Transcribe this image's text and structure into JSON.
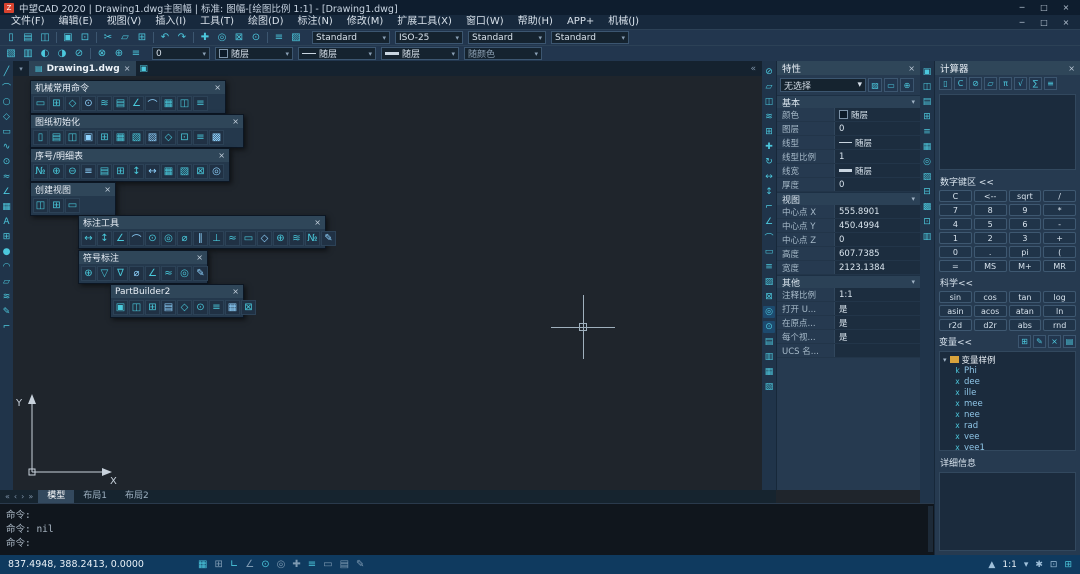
{
  "ui": {
    "chevron_down": "▾",
    "close": "×",
    "collapse": "«",
    "min": "─",
    "max": "□"
  },
  "titlebar": {
    "logo_glyph": "Z",
    "title": "中望CAD 2020 | Drawing1.dwg主图幅 | 标准: 图幅-[绘图比例 1:1] - [Drawing1.dwg]"
  },
  "menubar": {
    "items": [
      "文件(F)",
      "编辑(E)",
      "视图(V)",
      "插入(I)",
      "工具(T)",
      "绘图(D)",
      "标注(N)",
      "修改(M)",
      "扩展工具(X)",
      "窗口(W)",
      "帮助(H)",
      "APP+",
      "机械(J)"
    ]
  },
  "toolbar1": {
    "icons": [
      {
        "n": "new-icon",
        "g": "▯"
      },
      {
        "n": "open-icon",
        "g": "▤"
      },
      {
        "n": "save-icon",
        "g": "◫"
      },
      {
        "n": "separator",
        "cls": "sep"
      },
      {
        "n": "plot-icon",
        "g": "▣"
      },
      {
        "n": "preview-icon",
        "g": "⊡"
      },
      {
        "n": "separator",
        "cls": "sep"
      },
      {
        "n": "cut-icon",
        "g": "✂"
      },
      {
        "n": "copy-icon",
        "g": "▱"
      },
      {
        "n": "paste-icon",
        "g": "⊞"
      },
      {
        "n": "separator",
        "cls": "sep"
      },
      {
        "n": "undo-icon",
        "g": "↶"
      },
      {
        "n": "redo-icon",
        "g": "↷"
      },
      {
        "n": "separator",
        "cls": "sep"
      },
      {
        "n": "pan-icon",
        "g": "✚"
      },
      {
        "n": "zoom-realtime-icon",
        "g": "◎"
      },
      {
        "n": "zoom-window-icon",
        "g": "⊠"
      },
      {
        "n": "zoom-previous-icon",
        "g": "⊙"
      },
      {
        "n": "separator",
        "cls": "sep"
      },
      {
        "n": "properties-icon",
        "g": "≡"
      },
      {
        "n": "match-properties-icon",
        "g": "▨"
      }
    ],
    "combos": [
      {
        "n": "text-style-combo",
        "value": "Standard"
      },
      {
        "n": "dim-style-combo",
        "value": "ISO-25"
      },
      {
        "n": "table-style-combo",
        "value": "Standard"
      },
      {
        "n": "mleader-style-combo",
        "value": "Standard"
      }
    ]
  },
  "toolbar2": {
    "icons": [
      {
        "n": "layer-properties-icon",
        "g": "▧"
      },
      {
        "n": "layer-states-icon",
        "g": "▥"
      },
      {
        "n": "layer-on-icon",
        "g": "◐"
      },
      {
        "n": "layer-freeze-icon",
        "g": "◑"
      },
      {
        "n": "layer-lock-icon",
        "g": "⊘"
      },
      {
        "n": "separator",
        "cls": "sep"
      },
      {
        "n": "layer-isolate-icon",
        "g": "⊗"
      },
      {
        "n": "layer-previous-icon",
        "g": "⊕"
      },
      {
        "n": "layer-walk-icon",
        "g": "≡"
      }
    ],
    "combos": [
      {
        "n": "layer-combo",
        "value": "0"
      },
      {
        "n": "color-combo",
        "value": "随层",
        "cls": "sw"
      },
      {
        "n": "linetype-combo",
        "value": "随层",
        "cls": "dash"
      },
      {
        "n": "lineweight-combo",
        "value": "随层",
        "cls": "thick"
      },
      {
        "n": "plotstyle-combo",
        "value": "随颜色",
        "cls": "dim"
      }
    ]
  },
  "docbar": {
    "tab": "Drawing1.dwg",
    "tab_icon": "▤",
    "new_tab_icon": "▣"
  },
  "left_toolbar": {
    "icons": [
      "╱",
      "⌒",
      "○",
      "◇",
      "▭",
      "∿",
      "⊙",
      "≈",
      "∠",
      "▦",
      "A",
      "⊞",
      "●",
      "◠",
      "▱",
      "≋",
      "✎",
      "⌐"
    ]
  },
  "right_strip1": {
    "icons": [
      "⊘",
      "▱",
      "◫",
      "≋",
      "⊞",
      "✚",
      "↻",
      "↔",
      "↕",
      "⌐",
      "∠",
      "⌒",
      "▭",
      "≡",
      "▨",
      "⊠",
      "◎",
      "⊙",
      "▤",
      "▥",
      "▦",
      "▧"
    ]
  },
  "right_strip2": {
    "icons": [
      "▣",
      "◫",
      "▤",
      "⊞",
      "≡",
      "▦",
      "◎",
      "▨",
      "⊟",
      "▩",
      "⊡",
      "▥"
    ]
  },
  "palettes": {
    "p1": {
      "title": "机械常用命令",
      "icons": [
        "▭",
        "⊞",
        "◇",
        "⊙",
        "≋",
        "▤",
        "∠",
        "⌒",
        "▦",
        "◫",
        "≡"
      ]
    },
    "p2": {
      "title": "图纸初始化",
      "icons": [
        "▯",
        "▤",
        "◫",
        "▣",
        "⊞",
        "▦",
        "▧",
        "▨",
        "◇",
        "⊡",
        "≡",
        "▩"
      ]
    },
    "p3": {
      "title": "序号/明细表",
      "icons": [
        "№",
        "⊕",
        "⊖",
        "≡",
        "▤",
        "⊞",
        "↕",
        "↔",
        "▦",
        "▧",
        "⊠",
        "◎"
      ]
    },
    "p4": {
      "title": "创建视图",
      "icons": [
        "◫",
        "⊞",
        "▭"
      ]
    },
    "p5": {
      "title": "标注工具",
      "icons": [
        "↔",
        "↕",
        "∠",
        "⌒",
        "⊙",
        "◎",
        "⌀",
        "∥",
        "⊥",
        "≈",
        "▭",
        "◇",
        "⊕",
        "≋",
        "№",
        "✎"
      ]
    },
    "p6": {
      "title": "符号标注",
      "icons": [
        "⊕",
        "▽",
        "∇",
        "⌀",
        "∠",
        "≈",
        "◎",
        "✎"
      ]
    },
    "p7": {
      "title": "PartBuilder2",
      "icons": [
        "▣",
        "◫",
        "⊞",
        "▤",
        "◇",
        "⊙",
        "≡",
        "▦",
        "⊠"
      ]
    }
  },
  "props": {
    "title": "特性",
    "selector": "无选择",
    "selector_icons": [
      {
        "n": "quick-select-icon",
        "g": "▨"
      },
      {
        "n": "select-objects-icon",
        "g": "▭"
      },
      {
        "n": "pickadd-toggle-icon",
        "g": "⊕"
      }
    ],
    "sections": {
      "basic": {
        "title": "基本",
        "rows": [
          {
            "label": "颜色",
            "value": "随层",
            "cls": "sw"
          },
          {
            "label": "图层",
            "value": "0"
          },
          {
            "label": "线型",
            "value": "随层",
            "cls": "dash"
          },
          {
            "label": "线型比例",
            "value": "1"
          },
          {
            "label": "线宽",
            "value": "随层",
            "cls": "thick"
          },
          {
            "label": "厚度",
            "value": "0"
          }
        ]
      },
      "view": {
        "title": "视图",
        "rows": [
          {
            "label": "中心点 X",
            "value": "555.8901"
          },
          {
            "label": "中心点 Y",
            "value": "450.4994"
          },
          {
            "label": "中心点 Z",
            "value": "0"
          },
          {
            "label": "高度",
            "value": "607.7385"
          },
          {
            "label": "宽度",
            "value": "2123.1384"
          }
        ]
      },
      "misc": {
        "title": "其他",
        "rows": [
          {
            "label": "注释比例",
            "value": "1:1"
          },
          {
            "label": "打开 U...",
            "value": "是"
          },
          {
            "label": "在原点...",
            "value": "是"
          },
          {
            "label": "每个视...",
            "value": "是"
          },
          {
            "label": "UCS 名...",
            "value": ""
          }
        ]
      }
    }
  },
  "calc": {
    "title": "计算器",
    "toolbar": [
      {
        "n": "new-calc-icon",
        "g": "▯"
      },
      {
        "n": "clear-icon",
        "g": "C"
      },
      {
        "n": "clear-history-icon",
        "g": "⊘"
      },
      {
        "n": "paste-value-icon",
        "g": "▱"
      },
      {
        "n": "units-conversion-icon",
        "g": "π"
      },
      {
        "n": "sqrt-icon",
        "g": "√"
      },
      {
        "n": "sum-icon",
        "g": "∑"
      },
      {
        "n": "options-icon",
        "g": "≡"
      }
    ],
    "numpad_label": "数字键区 <<",
    "numpad": [
      "C",
      "<--",
      "sqrt",
      "/",
      "7",
      "8",
      "9",
      "*",
      "4",
      "5",
      "6",
      "-",
      "1",
      "2",
      "3",
      "+",
      "0",
      ".",
      "pi",
      "(",
      "=",
      "MS",
      "M+",
      "MR"
    ],
    "sci_label": "科学<<",
    "sci": [
      "sin",
      "cos",
      "tan",
      "log",
      "asin",
      "acos",
      "atan",
      "ln",
      "r2d",
      "d2r",
      "abs",
      "rnd"
    ],
    "vars_label": "变量<<",
    "vars_toolbar": [
      {
        "n": "new-variable-icon",
        "g": "⊞"
      },
      {
        "n": "edit-variable-icon",
        "g": "✎"
      },
      {
        "n": "delete-variable-icon",
        "g": "×"
      },
      {
        "n": "return-value-icon",
        "g": "▤"
      }
    ],
    "tree": {
      "folder": "变量样例",
      "items": [
        {
          "t": "k",
          "name": "Phi"
        },
        {
          "t": "x",
          "name": "dee"
        },
        {
          "t": "x",
          "name": "ille"
        },
        {
          "t": "x",
          "name": "mee"
        },
        {
          "t": "x",
          "name": "nee"
        },
        {
          "t": "x",
          "name": "rad"
        },
        {
          "t": "x",
          "name": "vee"
        },
        {
          "t": "x",
          "name": "vee1"
        }
      ]
    },
    "details_label": "详细信息"
  },
  "modeltabs": {
    "arrows": [
      "«",
      "‹",
      "›",
      "»"
    ],
    "tabs": [
      {
        "n": "tab-model",
        "label": "模型",
        "cls": "active"
      },
      {
        "n": "tab-layout1",
        "label": "布局1"
      },
      {
        "n": "tab-layout2",
        "label": "布局2"
      }
    ]
  },
  "cmd": {
    "lines": [
      "命令:",
      "命令: nil",
      "命令:"
    ]
  },
  "status": {
    "coords": "837.4948, 388.2413, 0.0000",
    "icons": [
      {
        "n": "snap-icon",
        "g": "▦",
        "cls": "on"
      },
      {
        "n": "grid-icon",
        "g": "⊞"
      },
      {
        "n": "ortho-icon",
        "g": "∟",
        "cls": "on"
      },
      {
        "n": "polar-icon",
        "g": "∠"
      },
      {
        "n": "osnap-icon",
        "g": "⊙",
        "cls": "on"
      },
      {
        "n": "otrack-icon",
        "g": "◎"
      },
      {
        "n": "dyn-ucs-icon",
        "g": "✚"
      },
      {
        "n": "lineweight-display-icon",
        "g": "≡",
        "cls": "on"
      },
      {
        "n": "dynamic-input-icon",
        "g": "▭"
      },
      {
        "n": "quick-properties-icon",
        "g": "▤"
      },
      {
        "n": "annotation-monitor-icon",
        "g": "✎"
      }
    ],
    "right": [
      {
        "n": "annotation-visibility-icon",
        "g": "▲"
      },
      {
        "n": "annotation-scale-value",
        "g": "1:1",
        "cls": "txt"
      },
      {
        "n": "chevron-down-icon",
        "g": "▾"
      },
      {
        "n": "workspace-icon",
        "g": "✱"
      },
      {
        "n": "clean-screen-icon",
        "g": "⊡"
      },
      {
        "n": "fullscreen-icon",
        "g": "⊞",
        "cls": "on"
      }
    ]
  },
  "ucs": {
    "x": "X",
    "y": "Y"
  }
}
